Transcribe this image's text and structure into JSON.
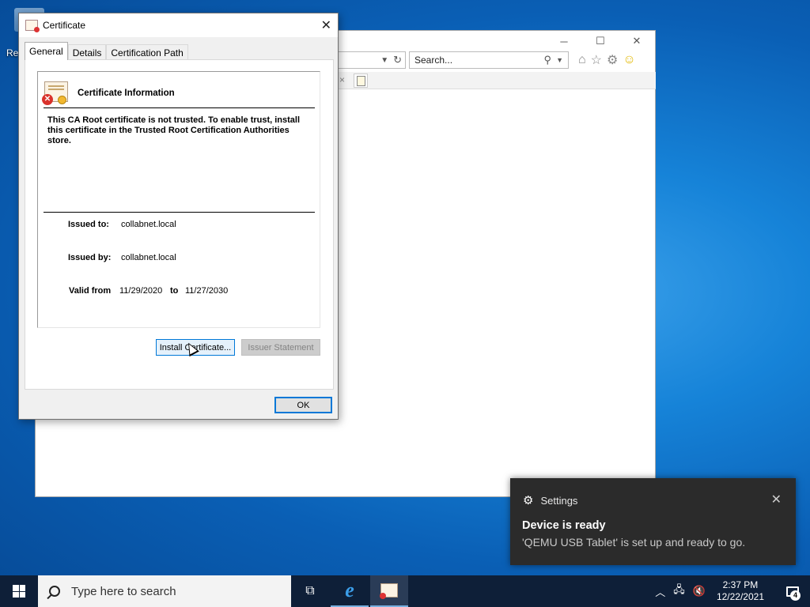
{
  "desktop": {
    "icon_label": "Re"
  },
  "ie_window": {
    "search_placeholder": "Search...",
    "tab_close": "×"
  },
  "dialog": {
    "title": "Certificate",
    "tabs": [
      {
        "label": "General",
        "active": true
      },
      {
        "label": "Details",
        "active": false
      },
      {
        "label": "Certification Path",
        "active": false
      }
    ],
    "heading": "Certificate Information",
    "warning": "This CA Root certificate is not trusted. To enable trust, install this certificate in the Trusted Root Certification Authorities store.",
    "issued_to_label": "Issued to:",
    "issued_to_value": "collabnet.local",
    "issued_by_label": "Issued by:",
    "issued_by_value": "collabnet.local",
    "valid_from_label": "Valid from",
    "valid_from_value": "11/29/2020",
    "valid_to_label": "to",
    "valid_to_value": "11/27/2030",
    "install_button": "Install Certificate...",
    "issuer_button": "Issuer Statement",
    "ok_button": "OK"
  },
  "toast": {
    "app": "Settings",
    "title": "Device is ready",
    "body": "'QEMU USB Tablet' is set up and ready to go."
  },
  "taskbar": {
    "search_placeholder": "Type here to search",
    "time": "2:37 PM",
    "date": "12/22/2021",
    "notification_count": "4"
  },
  "icons": {
    "close": "close-icon",
    "gear": "gear-icon",
    "search": "search-icon",
    "windows": "windows-logo-icon"
  }
}
